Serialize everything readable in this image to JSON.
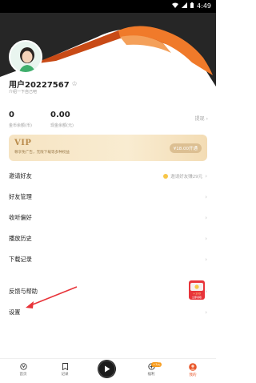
{
  "status_bar": {
    "time": "4:49"
  },
  "profile": {
    "username": "用户20227567",
    "bio": "介绍一下自己吧"
  },
  "stats": {
    "gold_value": "0",
    "gold_label": "金币余额(币)",
    "cash_value": "0.00",
    "cash_label": "现金余额(元)",
    "withdraw_label": "提现"
  },
  "vip": {
    "title": "VIP",
    "description": "尊享免广告，无限下载等多种权益",
    "button_label": "¥18.00开通"
  },
  "menu": {
    "invite": "邀请好友",
    "invite_reward": "邀请好友赚29元",
    "friends": "好友管理",
    "favorites": "收听偏好",
    "history": "播放历史",
    "downloads": "下载记录",
    "feedback": "反馈与帮助",
    "settings": "设置"
  },
  "float_badge": {
    "amount": "+100",
    "label": "立即领取"
  },
  "bottom_nav": {
    "home": "首页",
    "record": "记录",
    "welfare": "福利",
    "welfare_badge": "+3元",
    "mine": "我的"
  },
  "colors": {
    "accent": "#e8562a",
    "header_orange": "#f07a2a",
    "vip_gold": "#b98b4b",
    "annotation_arrow": "#e8343a"
  }
}
